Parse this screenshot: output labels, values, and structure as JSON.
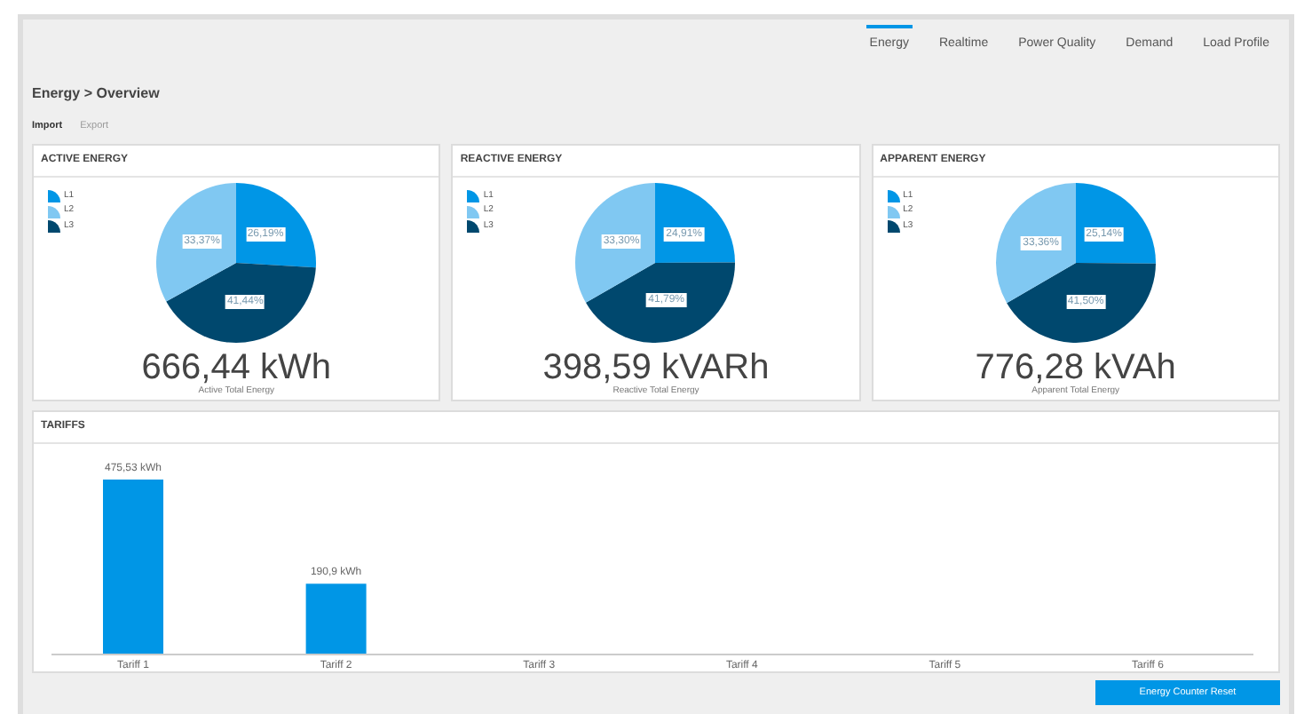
{
  "tabs": [
    {
      "label": "Energy",
      "selected": true
    },
    {
      "label": "Realtime",
      "selected": false
    },
    {
      "label": "Power Quality",
      "selected": false
    },
    {
      "label": "Demand",
      "selected": false
    },
    {
      "label": "Load Profile",
      "selected": false
    }
  ],
  "breadcrumb": "Energy > Overview",
  "subtabs": [
    {
      "label": "Import",
      "selected": true
    },
    {
      "label": "Export",
      "selected": false
    }
  ],
  "cards": [
    {
      "title": "ACTIVE ENERGY",
      "total": "666,44 kWh",
      "caption": "Active Total Energy",
      "chart_data": {
        "type": "pie",
        "categories": [
          "L1",
          "L2",
          "L3"
        ],
        "values": [
          26.19,
          33.37,
          41.44
        ],
        "colors": [
          "#0096e6",
          "#80c8f2",
          "#00486e"
        ],
        "value_labels": [
          "26,19%",
          "33,37%",
          "41,44%"
        ]
      }
    },
    {
      "title": "REACTIVE ENERGY",
      "total": "398,59 kVARh",
      "caption": "Reactive Total Energy",
      "chart_data": {
        "type": "pie",
        "categories": [
          "L1",
          "L2",
          "L3"
        ],
        "values": [
          24.91,
          33.3,
          41.79
        ],
        "colors": [
          "#0096e6",
          "#80c8f2",
          "#00486e"
        ],
        "value_labels": [
          "24,91%",
          "33,30%",
          "41,79%"
        ]
      }
    },
    {
      "title": "APPARENT ENERGY",
      "total": "776,28 kVAh",
      "caption": "Apparent Total Energy",
      "chart_data": {
        "type": "pie",
        "categories": [
          "L1",
          "L2",
          "L3"
        ],
        "values": [
          25.14,
          33.36,
          41.5
        ],
        "colors": [
          "#0096e6",
          "#80c8f2",
          "#00486e"
        ],
        "value_labels": [
          "25,14%",
          "33,36%",
          "41,50%"
        ]
      }
    }
  ],
  "tariffs": {
    "title": "TARIFFS",
    "chart_data": {
      "type": "bar",
      "categories": [
        "Tariff 1",
        "Tariff 2",
        "Tariff 3",
        "Tariff 4",
        "Tariff 5",
        "Tariff 6"
      ],
      "color": "#0096e6",
      "values": [
        475.53,
        190.9,
        0,
        0,
        0,
        0
      ],
      "value_labels": [
        "475,53 kWh",
        "190,9 kWh",
        null,
        null,
        null,
        null
      ]
    }
  },
  "reset_button": "Energy Counter Reset"
}
